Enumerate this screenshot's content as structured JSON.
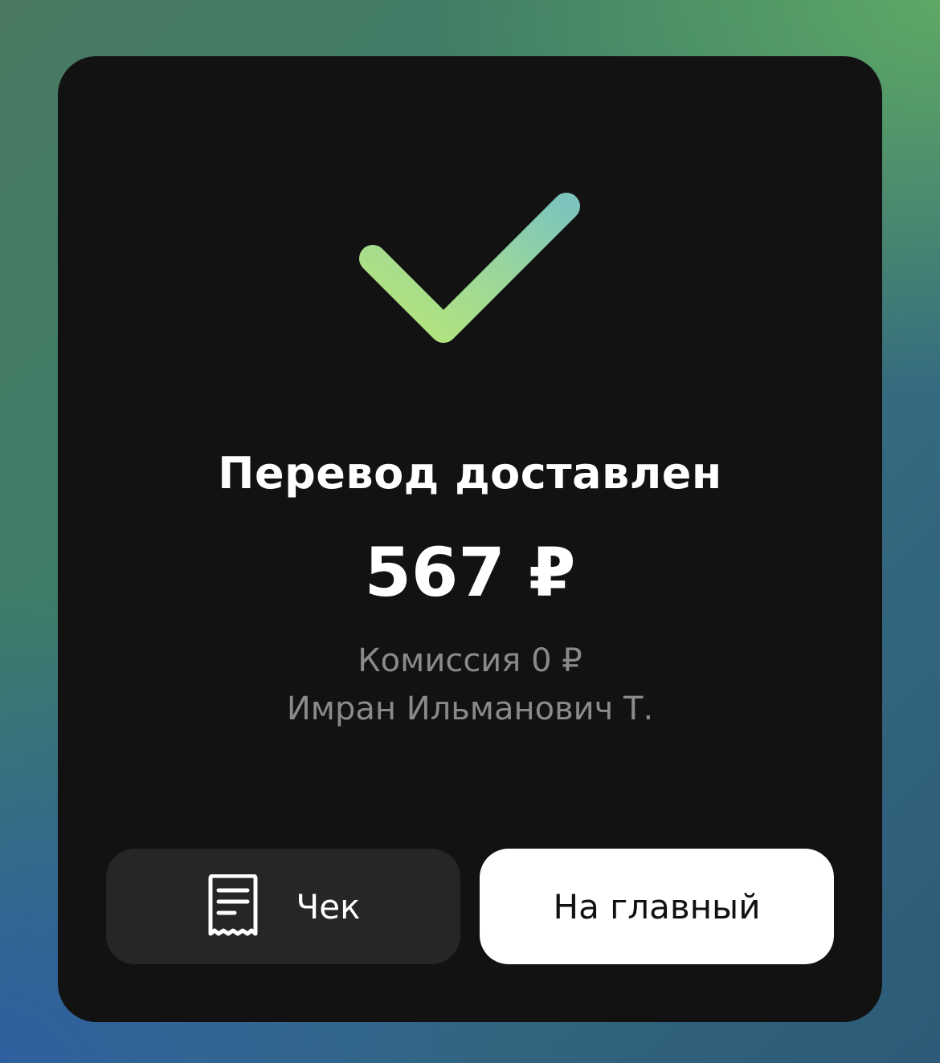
{
  "status": {
    "title": "Перевод доставлен",
    "amount": "567 ₽",
    "fee": "Комиссия 0 ₽",
    "recipient": "Имран Ильманович Т."
  },
  "icons": {
    "status": "checkmark-icon",
    "receipt": "receipt-icon"
  },
  "actions": {
    "receipt_label": "Чек",
    "home_label": "На главный"
  },
  "colors": {
    "card_background": "#121212",
    "check_gradient_start": "#b6e57a",
    "check_gradient_end": "#7ec6b9",
    "secondary_text": "#8a8a8a",
    "receipt_button": "#262626",
    "home_button": "#ffffff"
  }
}
